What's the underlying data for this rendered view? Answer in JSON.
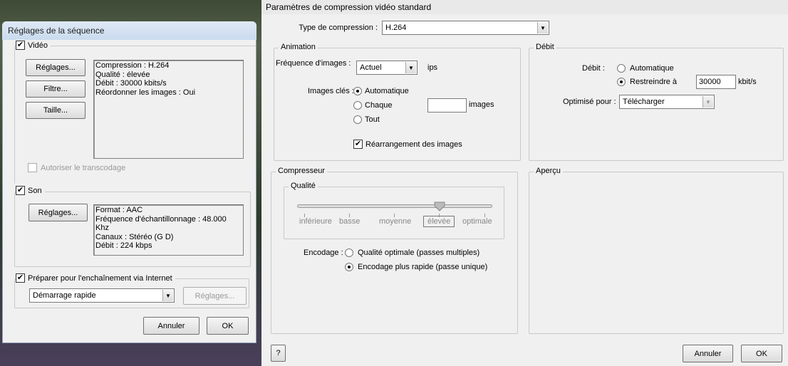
{
  "left_dialog": {
    "title": "Réglages de la séquence",
    "video": {
      "label": "Vidéo",
      "checked": true,
      "buttons": [
        "Réglages...",
        "Filtre...",
        "Taille..."
      ],
      "info": [
        "Compression : H.264",
        "Qualité : élevée",
        "Débit : 30000 kbits/s",
        "Réordonner les images : Oui"
      ],
      "transcode_label": "Autoriser le transcodage"
    },
    "sound": {
      "label": "Son",
      "checked": true,
      "button": "Réglages...",
      "info": [
        "Format : AAC",
        "Fréquence d'échantillonnage : 48.000 Khz",
        "Canaux : Stéréo (G D)",
        "Débit : 224 kbps"
      ]
    },
    "internet": {
      "label": "Préparer pour l'enchaînement via Internet",
      "checked": true,
      "select": "Démarrage rapide",
      "button": "Réglages..."
    },
    "cancel": "Annuler",
    "ok": "OK"
  },
  "right_dialog": {
    "title": "Paramètres de compression vidéo standard",
    "compression_type_label": "Type de compression :",
    "compression_type": "H.264",
    "animation": {
      "label": "Animation",
      "fps_label": "Fréquence d'images :",
      "fps": "Actuel",
      "fps_unit": "ips",
      "keyframes_label": "Images clés :",
      "kf_auto": "Automatique",
      "kf_every": "Chaque",
      "kf_every_value": "",
      "kf_unit": "images",
      "kf_all": "Tout",
      "reorder_label": "Réarrangement des images",
      "reorder_checked": true
    },
    "bitrate": {
      "label": "Débit",
      "bitrate_label": "Débit :",
      "auto": "Automatique",
      "limit": "Restreindre à",
      "limit_value": "30000",
      "unit": "kbit/s",
      "optimize_label": "Optimisé pour :",
      "optimize": "Télécharger"
    },
    "compressor": {
      "label": "Compresseur",
      "quality_label": "Qualité",
      "levels": [
        "inférieure",
        "basse",
        "moyenne",
        "élevée",
        "optimale"
      ],
      "selected_level": "élevée",
      "encoding_label": "Encodage :",
      "enc_multi": "Qualité optimale (passes multiples)",
      "enc_single": "Encodage plus rapide (passe unique)"
    },
    "preview_label": "Aperçu",
    "help": "?",
    "cancel": "Annuler",
    "ok": "OK"
  }
}
